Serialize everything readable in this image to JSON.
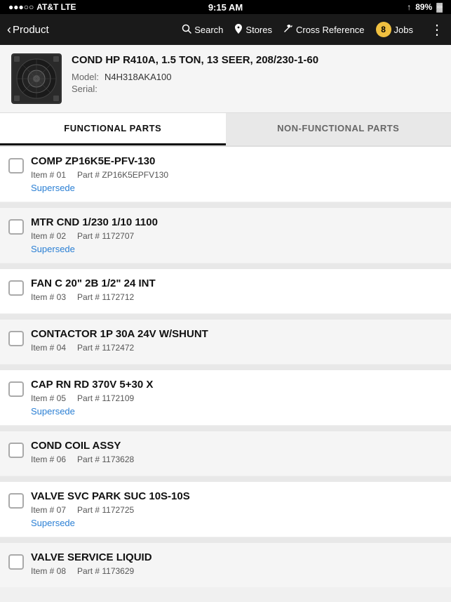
{
  "statusBar": {
    "carrier": "AT&T  LTE",
    "time": "9:15 AM",
    "batteryIcon": "89%",
    "signalIcon": "↑"
  },
  "navBar": {
    "backLabel": "Product",
    "actions": [
      {
        "id": "search",
        "icon": "🔍",
        "label": "Search"
      },
      {
        "id": "stores",
        "icon": "📍",
        "label": "Stores"
      },
      {
        "id": "crossRef",
        "icon": "🔧",
        "label": "Cross Reference"
      }
    ],
    "jobsBadgeCount": "8",
    "jobsLabel": "Jobs",
    "moreIcon": "⋮"
  },
  "product": {
    "title": "COND HP R410A, 1.5 TON, 13 SEER, 208/230-1-60",
    "modelLabel": "Model:",
    "modelValue": "N4H318AKA100",
    "serialLabel": "Serial:"
  },
  "tabs": [
    {
      "id": "functional",
      "label": "FUNCTIONAL PARTS",
      "active": true
    },
    {
      "id": "nonFunctional",
      "label": "NON-FUNCTIONAL PARTS",
      "active": false
    }
  ],
  "parts": [
    {
      "id": 1,
      "name": "COMP ZP16K5E-PFV-130",
      "itemNum": "Item # 01",
      "partNum": "Part # ZP16K5EPFV130",
      "supersede": true,
      "supersedeLabel": "Supersede",
      "checked": false
    },
    {
      "id": 2,
      "name": "MTR CND 1/230 1/10 1100",
      "itemNum": "Item # 02",
      "partNum": "Part # 1172707",
      "supersede": true,
      "supersedeLabel": "Supersede",
      "checked": false
    },
    {
      "id": 3,
      "name": "FAN C 20\" 2B 1/2\" 24 INT",
      "itemNum": "Item # 03",
      "partNum": "Part # 1172712",
      "supersede": false,
      "checked": false
    },
    {
      "id": 4,
      "name": "CONTACTOR 1P 30A 24V W/SHUNT",
      "itemNum": "Item # 04",
      "partNum": "Part # 1172472",
      "supersede": false,
      "checked": false
    },
    {
      "id": 5,
      "name": "CAP RN RD 370V 5+30      X",
      "itemNum": "Item # 05",
      "partNum": "Part # 1172109",
      "supersede": true,
      "supersedeLabel": "Supersede",
      "checked": false
    },
    {
      "id": 6,
      "name": "COND COIL ASSY",
      "itemNum": "Item # 06",
      "partNum": "Part # 1173628",
      "supersede": false,
      "checked": false
    },
    {
      "id": 7,
      "name": "VALVE SVC PARK SUC 10S-10S",
      "itemNum": "Item # 07",
      "partNum": "Part # 1172725",
      "supersede": true,
      "supersedeLabel": "Supersede",
      "checked": false
    },
    {
      "id": 8,
      "name": "VALVE SERVICE LIQUID",
      "itemNum": "Item # 08",
      "partNum": "Part # 1173629",
      "supersede": false,
      "checked": false
    }
  ]
}
